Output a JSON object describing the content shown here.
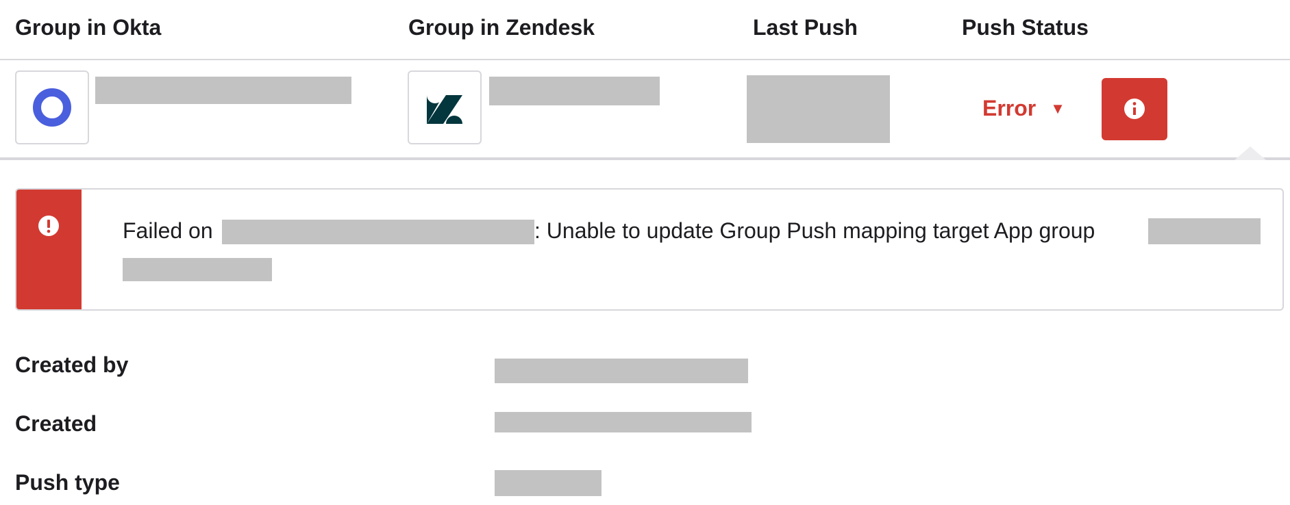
{
  "table": {
    "headers": {
      "okta": "Group in Okta",
      "zendesk": "Group in Zendesk",
      "last_push": "Last Push",
      "push_status": "Push Status"
    },
    "row": {
      "status_text": "Error",
      "status_caret": "▼"
    }
  },
  "error_banner": {
    "prefix": "Failed on",
    "message": ": Unable to update Group Push mapping target App group"
  },
  "details": {
    "created_by_label": "Created by",
    "created_label": "Created",
    "push_type_label": "Push type"
  },
  "icons": {
    "okta": "okta-logo-icon",
    "zendesk": "zendesk-logo-icon",
    "info": "info-icon",
    "alert": "alert-icon"
  },
  "colors": {
    "error_red": "#d23a31",
    "okta_blue": "#4a5fdd",
    "zendesk_dark": "#03363d"
  }
}
